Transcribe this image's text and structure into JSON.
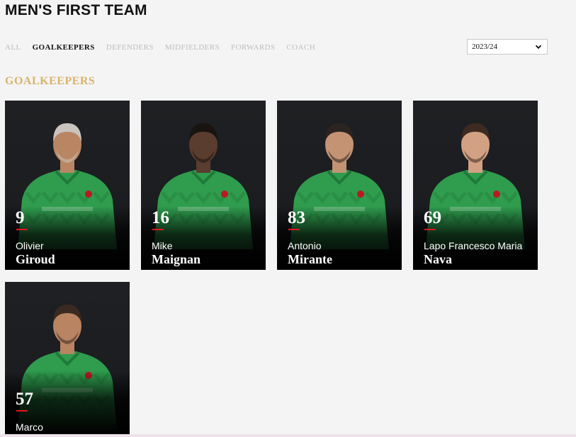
{
  "page": {
    "title": "MEN'S FIRST TEAM"
  },
  "filters": [
    {
      "label": "ALL",
      "active": false
    },
    {
      "label": "GOALKEEPERS",
      "active": true
    },
    {
      "label": "DEFENDERS",
      "active": false
    },
    {
      "label": "MIDFIELDERS",
      "active": false
    },
    {
      "label": "FORWARDS",
      "active": false
    },
    {
      "label": "COACH",
      "active": false
    }
  ],
  "season": {
    "selected": "2023/24",
    "icon": "chevron-down-icon"
  },
  "section": {
    "title": "GOALKEEPERS"
  },
  "players": [
    {
      "number": "9",
      "first_name": "Olivier",
      "last_name": "Giroud",
      "hair": "#c9c4bd",
      "skin": "#b98663"
    },
    {
      "number": "16",
      "first_name": "Mike",
      "last_name": "Maignan",
      "hair": "#1a1411",
      "skin": "#5a3d2e"
    },
    {
      "number": "83",
      "first_name": "Antonio",
      "last_name": "Mirante",
      "hair": "#2b2420",
      "skin": "#c39373"
    },
    {
      "number": "69",
      "first_name": "Lapo Francesco Maria",
      "last_name": "Nava",
      "hair": "#3d2a20",
      "skin": "#d2a184"
    },
    {
      "number": "57",
      "first_name": "Marco",
      "last_name": "",
      "hair": "#3a2a21",
      "skin": "#b88462"
    }
  ],
  "colors": {
    "accent": "#d8b36c",
    "red": "#e3171b",
    "kit": "#2f9c4e"
  }
}
